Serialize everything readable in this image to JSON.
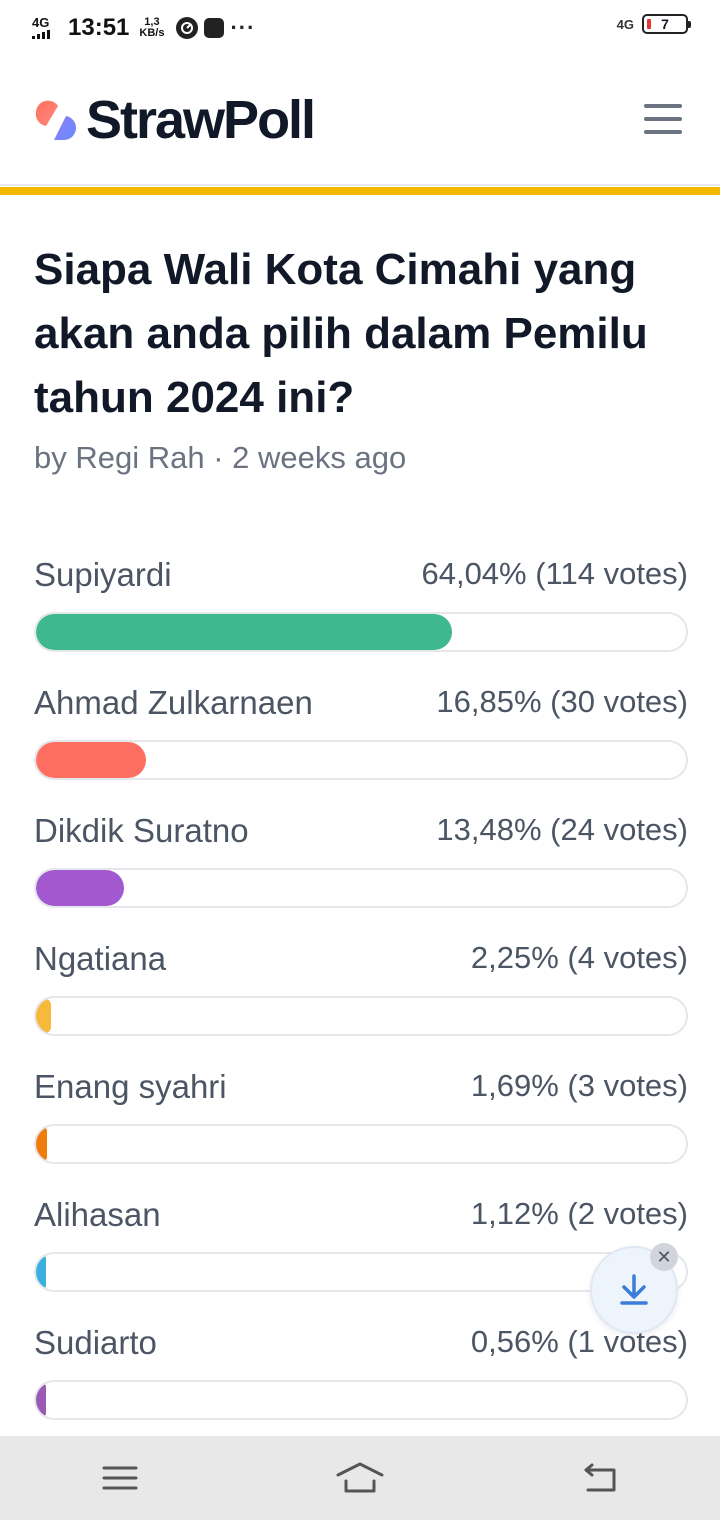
{
  "status_bar": {
    "network_left": "4G",
    "time": "13:51",
    "speed_value": "1,3",
    "speed_unit": "KB/s",
    "network_right": "4G",
    "battery": "7"
  },
  "header": {
    "logo_text": "StrawPoll",
    "accent_color": "#f5b800"
  },
  "poll": {
    "title": "Siapa Wali Kota Cimahi yang akan anda pilih dalam Pemilu tahun 2024 ini?",
    "meta": "by Regi Rah · 2 weeks ago",
    "options": [
      {
        "label": "Supiyardi",
        "stat": "64,04% (114 votes)",
        "percent": 64.04,
        "color": "#3db88f"
      },
      {
        "label": "Ahmad Zulkarnaen",
        "stat": "16,85% (30 votes)",
        "percent": 16.85,
        "color": "#ff6f61"
      },
      {
        "label": "Dikdik Suratno",
        "stat": "13,48% (24 votes)",
        "percent": 13.48,
        "color": "#a259cf"
      },
      {
        "label": "Ngatiana",
        "stat": "2,25% (4 votes)",
        "percent": 2.25,
        "color": "#f6b93b"
      },
      {
        "label": "Enang syahri",
        "stat": "1,69% (3 votes)",
        "percent": 1.69,
        "color": "#f07c0a"
      },
      {
        "label": "Alihasan",
        "stat": "1,12% (2 votes)",
        "percent": 1.12,
        "color": "#3bb0e0"
      },
      {
        "label": "Sudiarto",
        "stat": "0,56% (1 votes)",
        "percent": 0.56,
        "color": "#9b59b6"
      }
    ]
  },
  "fab": {
    "icon": "download-icon",
    "close_icon": "close-icon",
    "close_glyph": "✕"
  },
  "nav": {
    "icons": [
      "menu-icon",
      "home-icon",
      "back-icon"
    ]
  }
}
